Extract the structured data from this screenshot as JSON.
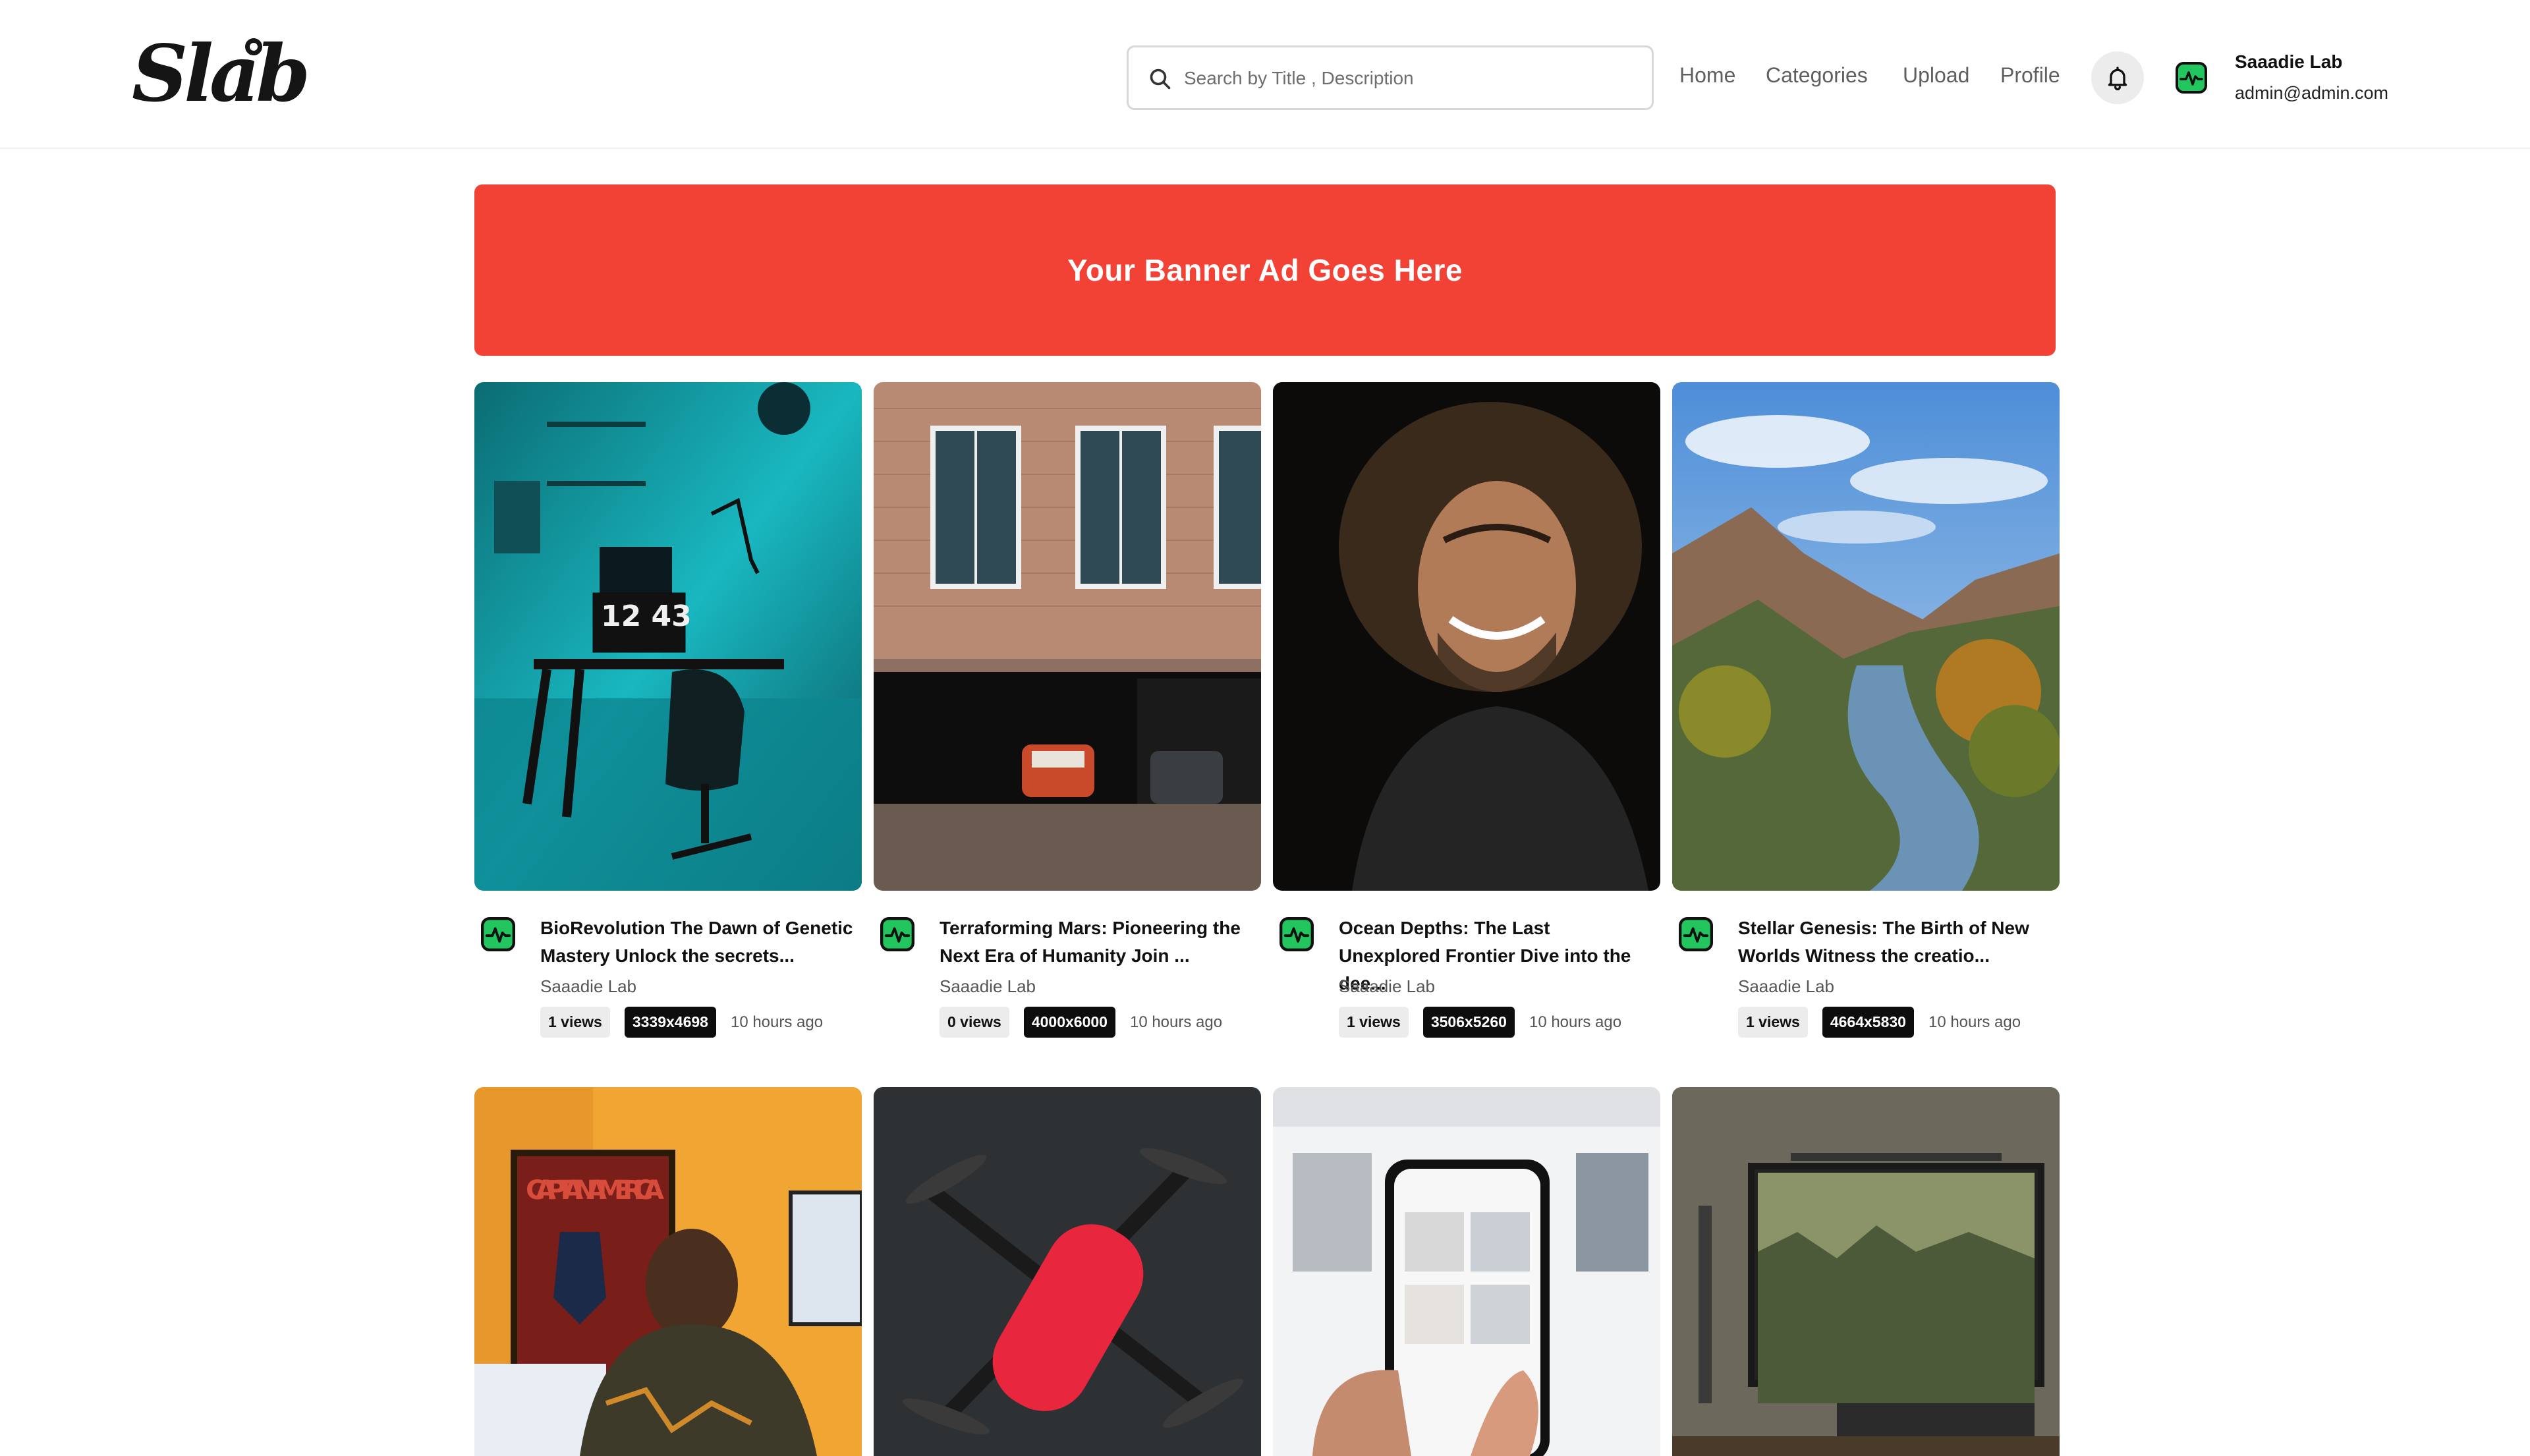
{
  "brand": {
    "logo_text": "Slab"
  },
  "search": {
    "placeholder": "Search by Title , Description"
  },
  "nav": {
    "home": "Home",
    "categories": "Categories",
    "upload": "Upload",
    "profile": "Profile"
  },
  "user": {
    "name": "Saaadie Lab",
    "email": "admin@admin.com"
  },
  "banner": {
    "text": "Your Banner Ad Goes Here",
    "color": "#f24236"
  },
  "accent": {
    "avatar_green": "#22c55e"
  },
  "cards": [
    {
      "title": "BioRevolution The Dawn of Genetic Mastery Unlock the secrets...",
      "author": "Saaadie Lab",
      "views": "1 views",
      "resolution": "3339x4698",
      "time": "10 hours ago"
    },
    {
      "title": "Terraforming Mars: Pioneering the Next Era of Humanity Join ...",
      "author": "Saaadie Lab",
      "views": "0 views",
      "resolution": "4000x6000",
      "time": "10 hours ago"
    },
    {
      "title": "Ocean Depths: The Last Unexplored Frontier Dive into the dee...",
      "author": "Saaadie Lab",
      "views": "1 views",
      "resolution": "3506x5260",
      "time": "10 hours ago"
    },
    {
      "title": "Stellar Genesis: The Birth of New Worlds Witness the creatio...",
      "author": "Saaadie Lab",
      "views": "1 views",
      "resolution": "4664x5830",
      "time": "10 hours ago"
    }
  ],
  "thumbnail_captions": {
    "desk_setup_clock": "12 43",
    "captain_poster": "CAPTAIN AMERICA"
  }
}
